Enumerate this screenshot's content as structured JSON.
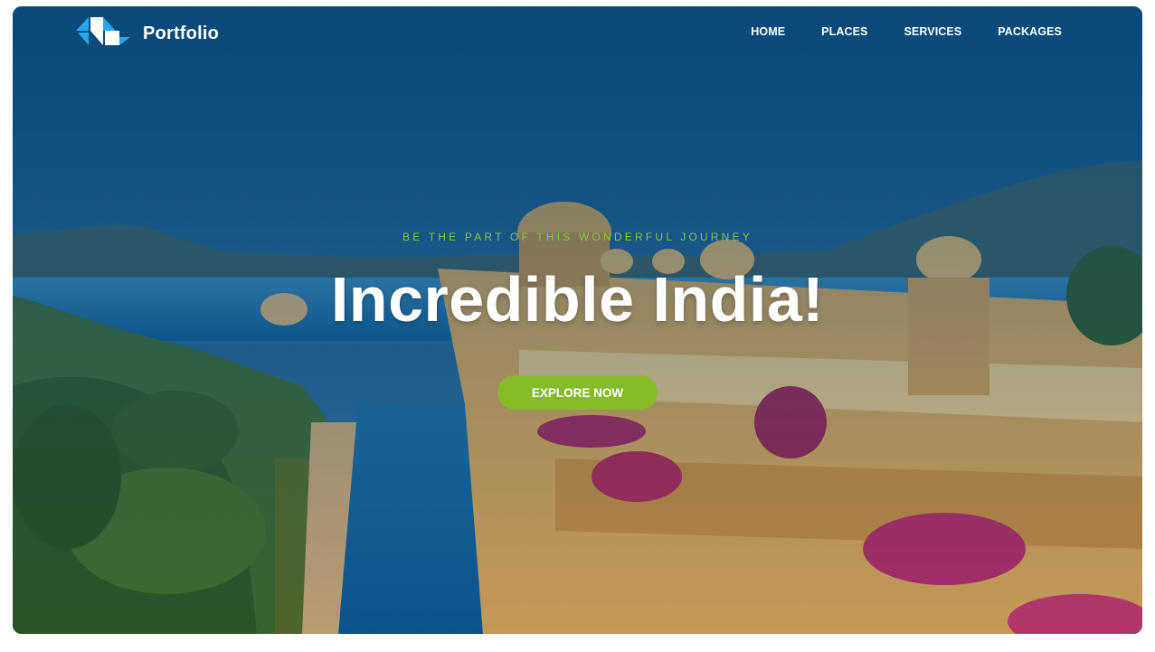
{
  "header": {
    "brand_name": "Portfolio",
    "logo_icon": "brand-logo-icon",
    "nav": [
      {
        "label": "HOME"
      },
      {
        "label": "PLACES"
      },
      {
        "label": "SERVICES"
      },
      {
        "label": "PACKAGES"
      }
    ]
  },
  "hero": {
    "tagline": "BE THE PART OF THIS WONDERFUL JOURNEY",
    "title": "Incredible India!",
    "cta_label": "EXPLORE NOW",
    "background_image": "lakeside-palace-hotel-photo"
  },
  "colors": {
    "accent": "#86bc28",
    "tagline": "#8dc63f",
    "overlay": "#0b4a78",
    "logo_blue": "#2aa6f0"
  }
}
